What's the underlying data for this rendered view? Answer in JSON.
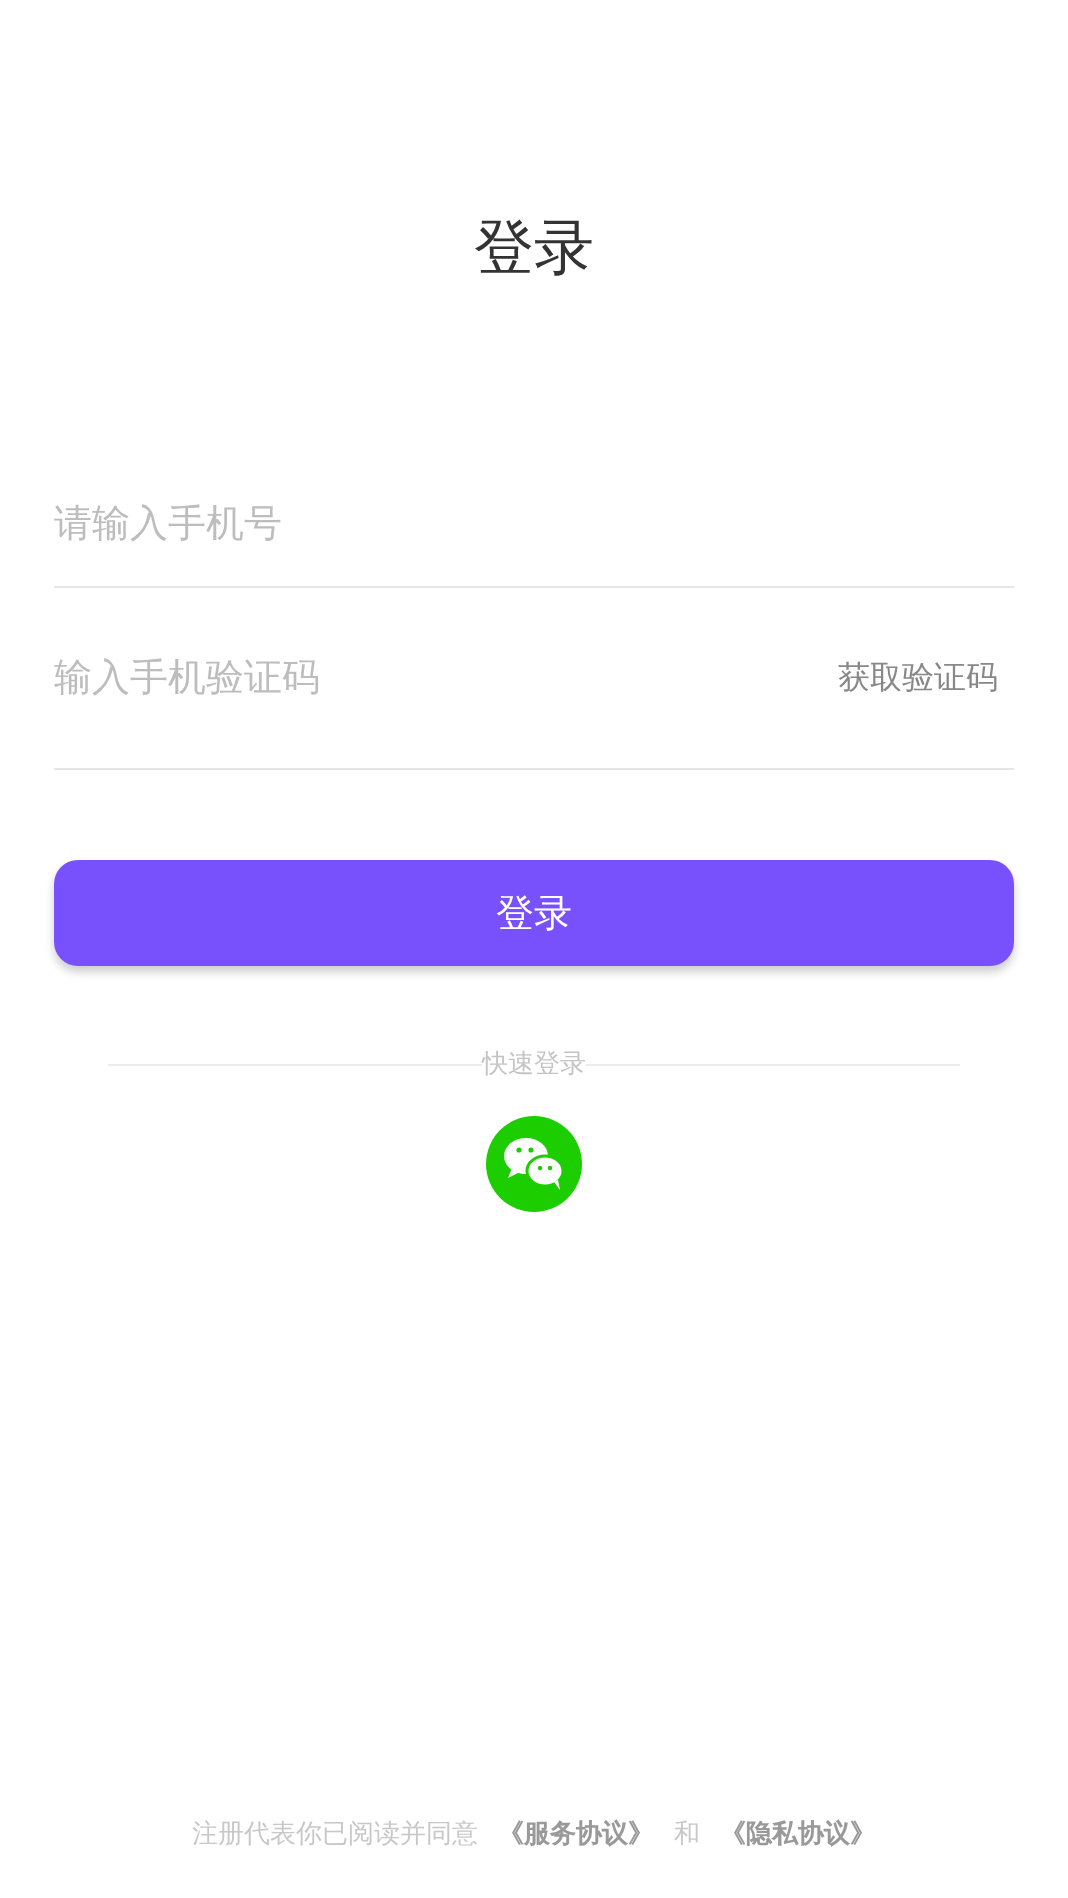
{
  "title": "登录",
  "fields": [
    {
      "placeholder": "请输入手机号"
    },
    {
      "placeholder": "输入手机验证码",
      "action": "获取验证码"
    }
  ],
  "login_button": "登录",
  "quick_login": {
    "label": "快速登录"
  },
  "footer": {
    "text": "注册代表你已阅读并同意",
    "links": [
      "《服务协议》",
      "《隐私协议》"
    ],
    "joiner": "和"
  }
}
